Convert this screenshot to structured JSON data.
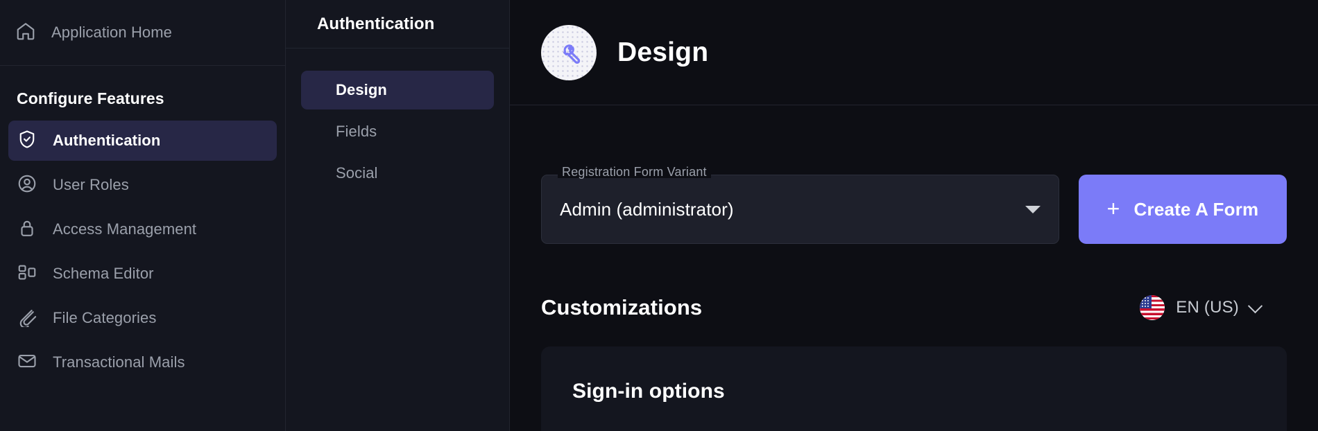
{
  "sidebar": {
    "home": {
      "label": "Application Home",
      "icon": "home-icon"
    },
    "section_title": "Configure Features",
    "items": [
      {
        "label": "Authentication",
        "icon": "shield-check-icon",
        "active": true
      },
      {
        "label": "User Roles",
        "icon": "user-circle-icon",
        "active": false
      },
      {
        "label": "Access Management",
        "icon": "lock-icon",
        "active": false
      },
      {
        "label": "Schema Editor",
        "icon": "layout-blocks-icon",
        "active": false
      },
      {
        "label": "File Categories",
        "icon": "paperclip-icon",
        "active": false
      },
      {
        "label": "Transactional Mails",
        "icon": "envelope-icon",
        "active": false
      }
    ]
  },
  "subnav": {
    "title": "Authentication",
    "items": [
      {
        "label": "Design",
        "active": true
      },
      {
        "label": "Fields",
        "active": false
      },
      {
        "label": "Social",
        "active": false
      }
    ]
  },
  "main": {
    "header": {
      "title": "Design",
      "icon": "wrench-icon"
    },
    "variant_field": {
      "legend": "Registration Form Variant",
      "value": "Admin (administrator)",
      "caret": "caret-down-icon"
    },
    "create_button": {
      "plus": "+",
      "label": "Create A Form"
    },
    "customizations": {
      "title": "Customizations",
      "language": {
        "flag": "flag-us-icon",
        "label": "EN (US)",
        "chevron": "chevron-down-icon"
      },
      "card": {
        "title": "Sign-in options"
      }
    }
  },
  "colors": {
    "accent": "#7b7bf8",
    "active_nav_bg": "#272746",
    "sidebar_bg": "#14161f",
    "main_bg": "#0d0e14",
    "muted_text": "#9ba0ab"
  }
}
